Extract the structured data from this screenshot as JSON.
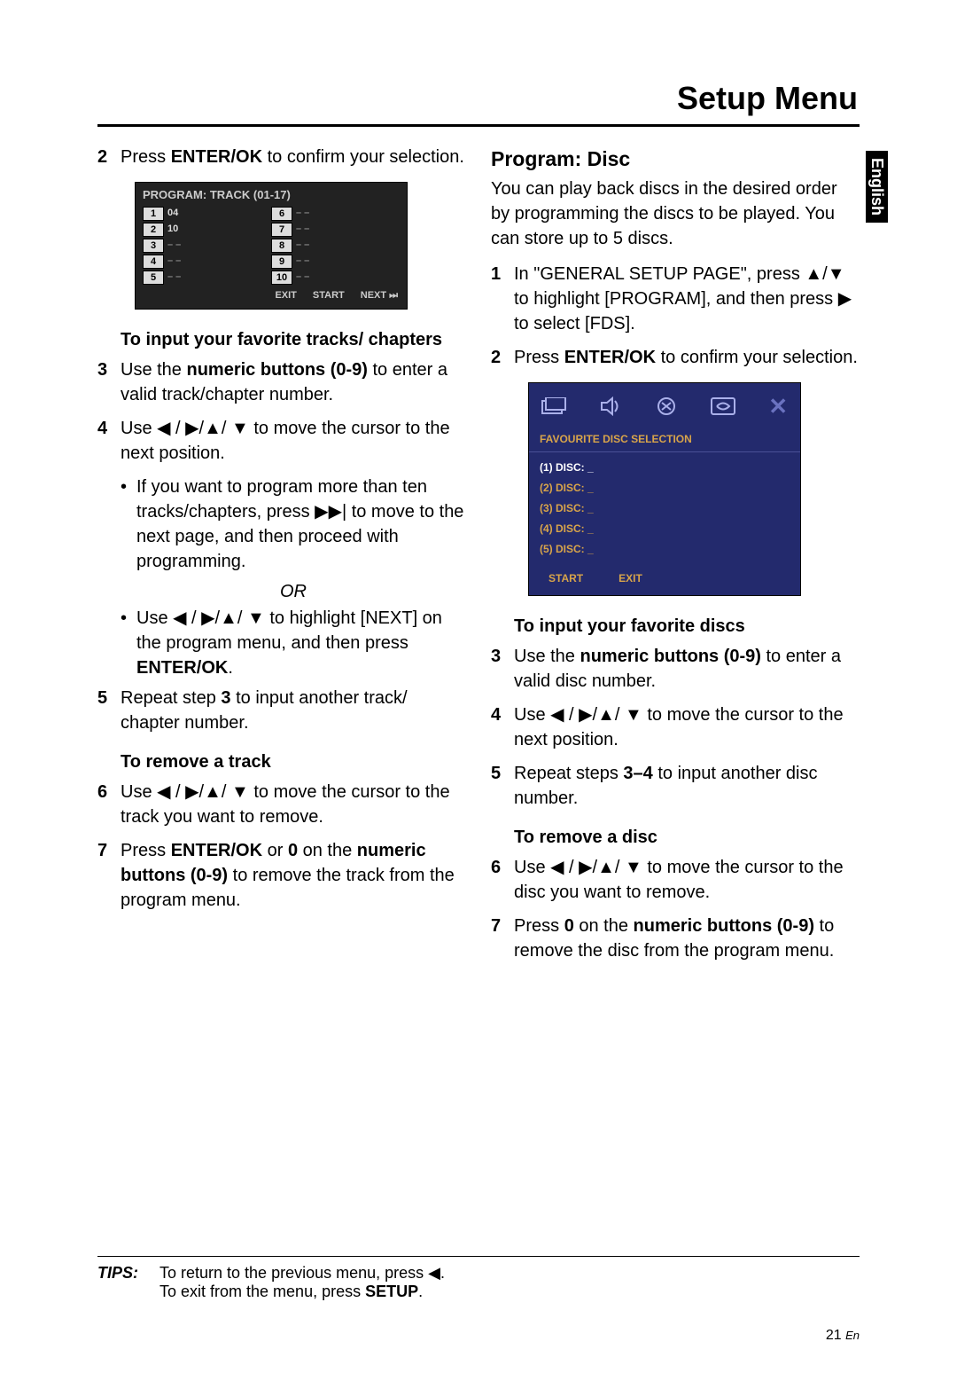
{
  "title": "Setup Menu",
  "langTab": "English",
  "left": {
    "step2": {
      "pre": "Press ",
      "bold": "ENTER/OK",
      "post": " to confirm your selection."
    },
    "osd1": {
      "title": "PROGRAM: TRACK (01-17)",
      "col1": [
        {
          "n": "1",
          "v": "04"
        },
        {
          "n": "2",
          "v": "10"
        },
        {
          "n": "3",
          "v": ""
        },
        {
          "n": "4",
          "v": ""
        },
        {
          "n": "5",
          "v": ""
        }
      ],
      "col2": [
        {
          "n": "6",
          "v": ""
        },
        {
          "n": "7",
          "v": ""
        },
        {
          "n": "8",
          "v": ""
        },
        {
          "n": "9",
          "v": ""
        },
        {
          "n": "10",
          "v": ""
        }
      ],
      "foot": {
        "exit": "EXIT",
        "start": "START",
        "next": "NEXT"
      }
    },
    "sub1": "To input your favorite tracks/ chapters",
    "step3": {
      "pre": "Use the ",
      "bold": "numeric buttons (0-9)",
      "post": " to enter a valid track/chapter number."
    },
    "step4": "Use ◀ / ▶/▲/ ▼ to move the cursor to the next position.",
    "bullet1": "If you want to program more than ten tracks/chapters, press ▶▶| to move to the next page, and then proceed with programming.",
    "or": "OR",
    "bullet2": {
      "pre": "Use ◀ / ▶/▲/ ▼ to highlight [NEXT] on the program menu, and then press ",
      "bold": "ENTER/OK",
      "post": "."
    },
    "step5": {
      "pre": "Repeat step ",
      "bold": "3",
      "post": " to input another track/ chapter number."
    },
    "sub2": "To remove a track",
    "step6": "Use ◀ / ▶/▲/ ▼ to move the cursor to the track you want to remove.",
    "step7": {
      "a": "Press ",
      "b": "ENTER/OK",
      "c": " or ",
      "d": "0",
      "e": " on the ",
      "f": "numeric buttons (0-9)",
      "g": " to remove the track from the program menu."
    }
  },
  "right": {
    "section": "Program: Disc",
    "intro": "You can play back discs in the desired order by programming the discs to be played. You can store up to 5 discs.",
    "step1": "In \"GENERAL SETUP PAGE\", press ▲/▼ to highlight [PROGRAM], and then press ▶ to select [FDS].",
    "step2": {
      "pre": "Press ",
      "bold": "ENTER/OK",
      "post": " to confirm your selection."
    },
    "osd2": {
      "title": "FAVOURITE DISC SELECTION",
      "items": [
        {
          "label": "(1) DISC: _",
          "sel": true
        },
        {
          "label": "(2) DISC: _",
          "sel": false
        },
        {
          "label": "(3) DISC: _",
          "sel": false
        },
        {
          "label": "(4) DISC: _",
          "sel": false
        },
        {
          "label": "(5) DISC: _",
          "sel": false
        }
      ],
      "foot": {
        "start": "START",
        "exit": "EXIT"
      }
    },
    "sub1": "To input your favorite discs",
    "step3": {
      "pre": "Use the ",
      "bold": "numeric buttons (0-9)",
      "post": " to enter a valid disc number."
    },
    "step4": "Use ◀ / ▶/▲/ ▼ to move the cursor to the next position.",
    "step5": {
      "pre": "Repeat steps ",
      "bold": "3–4",
      "post": " to input another disc number."
    },
    "sub2": "To remove a disc",
    "step6": "Use ◀ / ▶/▲/ ▼ to move the cursor to the disc you want to remove.",
    "step7": {
      "a": "Press ",
      "b": "0",
      "c": " on the ",
      "d": "numeric buttons (0-9)",
      "e": " to remove the disc from the program menu."
    }
  },
  "tips": {
    "label": "TIPS:",
    "line1": "To return to the previous menu, press ◀.",
    "line2_a": "To exit from the menu, press ",
    "line2_b": "SETUP",
    "line2_c": "."
  },
  "pageNum": {
    "n": "21",
    "lang": "En"
  }
}
